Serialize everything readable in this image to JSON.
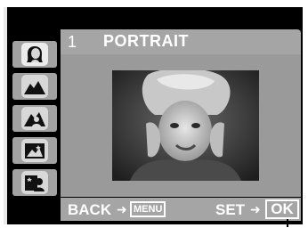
{
  "title_bar": {
    "number": "1",
    "mode_name": "PORTRAIT"
  },
  "scene_modes": [
    {
      "icon": "portrait-icon",
      "selected": true
    },
    {
      "icon": "landscape-icon",
      "selected": false
    },
    {
      "icon": "landscape-portrait-icon",
      "selected": false
    },
    {
      "icon": "night-scene-icon",
      "selected": false
    },
    {
      "icon": "night-portrait-icon",
      "selected": false
    }
  ],
  "guide_bar": {
    "back_label": "BACK",
    "menu_key": "MENU",
    "set_label": "SET",
    "ok_key": "OK"
  },
  "colors": {
    "bar_gray": "#a5a5a5",
    "panel_gray": "#9a9a9a",
    "frame_black": "#000000",
    "text_white": "#ffffff"
  }
}
